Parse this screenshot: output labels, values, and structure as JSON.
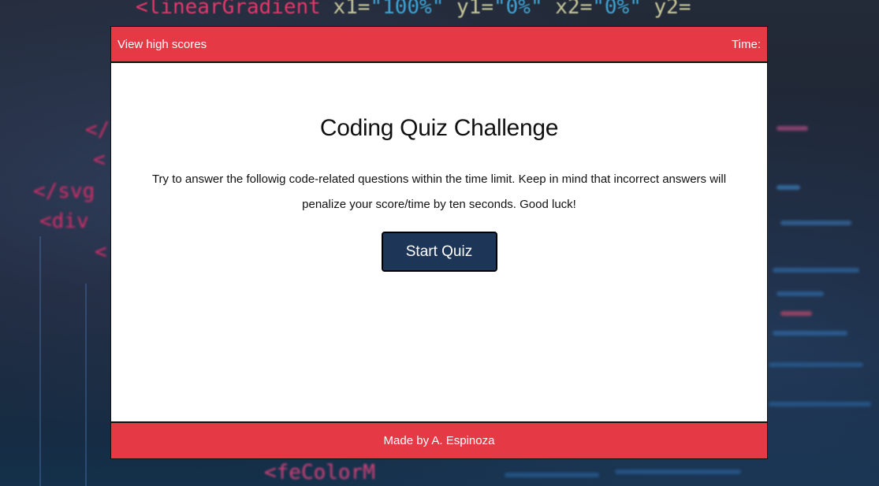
{
  "background": {
    "line1": {
      "tag": "<linearGradient",
      "a1": "x1=",
      "v1": "\"100%\"",
      "a2": "y1=",
      "v2": "\"0%\"",
      "a3": "x2=",
      "v3": "\"0%\"",
      "a4": "y2="
    },
    "line2": "</",
    "line3": "<",
    "line4": "</svg",
    "line5": "<div",
    "line6": "<",
    "line7": "<feColorM"
  },
  "header": {
    "high_scores_link": "View high scores",
    "timer_label": "Time:"
  },
  "main": {
    "title": "Coding Quiz Challenge",
    "intro": "Try to answer the followig code-related questions within the time limit. Keep in mind that incorrect answers will penalize your score/time by ten seconds. Good luck!",
    "start_button": "Start Quiz"
  },
  "footer": {
    "credit": "Made by A. Espinoza"
  },
  "colors": {
    "accent_red": "#e63946",
    "button_navy": "#1d3557"
  }
}
